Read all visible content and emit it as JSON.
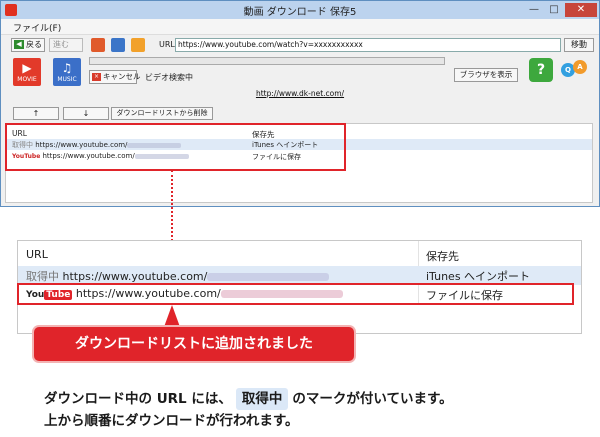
{
  "window": {
    "title": "動画 ダウンロード 保存5",
    "min_label": "—",
    "max_label": "□",
    "close_label": "✕"
  },
  "menu": {
    "file_label": "ファイル(F)"
  },
  "nav": {
    "back_label": "戻る",
    "back_arrow": "◀",
    "forward_label": "進む",
    "url_label": "URL",
    "url_value": "https://www.youtube.com/watch?v=xxxxxxxxxxx",
    "go_label": "移動"
  },
  "toolbar": {
    "movie_label": "MOVIE",
    "movie_symbol": "▶",
    "music_label": "MUSIC",
    "music_symbol": "♫",
    "progress_percent": 0,
    "cancel_symbol": "×",
    "cancel_label": "キャンセル",
    "status_text": "ビデオ検索中",
    "browser_button": "ブラウザを表示",
    "help_symbol": "?",
    "qa_q": "Q",
    "qa_a": "A"
  },
  "site_link": "http://www.dk-net.com/",
  "list_controls": {
    "up_label": "↑",
    "down_label": "↓",
    "remove_label": "ダウンロードリストから削除"
  },
  "download_list": {
    "columns": {
      "url": "URL",
      "destination": "保存先"
    },
    "rows": [
      {
        "marker": "取得中",
        "url": "https://www.youtube.com/",
        "destination": "iTunes へインポート"
      },
      {
        "marker_you": "You",
        "marker_tube": "Tube",
        "url": "https://www.youtube.com/",
        "destination": "ファイルに保存"
      }
    ]
  },
  "callout_text": "ダウンロードリストに追加されました",
  "explanation": {
    "line1_prefix": "ダウンロード中の URL には、",
    "badge": "取得中",
    "line1_suffix": "のマークが付いています。",
    "line2": "上から順番にダウンロードが行われます。"
  },
  "colors": {
    "highlight": "#e0242a",
    "selected_row": "#dfeaf7",
    "titlebar": "#bcd3ee"
  }
}
